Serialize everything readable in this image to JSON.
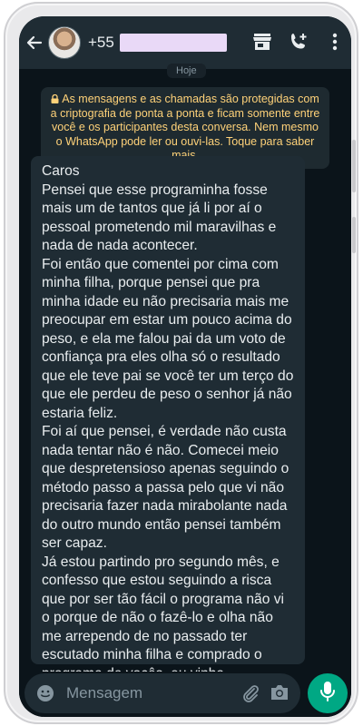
{
  "header": {
    "contact_number": "+55",
    "icons": [
      "back-arrow-icon",
      "avatar",
      "store-icon",
      "call-add-icon",
      "more-vert-icon"
    ]
  },
  "chat": {
    "date_label": "Hoje",
    "encryption_notice": "As mensagens e as chamadas são protegidas com a criptografia de ponta a ponta e ficam somente entre você e os participantes desta conversa. Nem mesmo o WhatsApp pode ler ou ouvi-las. Toque para saber mais.",
    "message_text": "Caros\nPensei que esse programinha fosse mais um de tantos que já li por aí o pessoal prometendo mil maravilhas e nada de nada acontecer.\nFoi então que comentei por cima com minha filha, porque pensei que pra minha idade eu não precisaria mais me preocupar em estar um pouco acima do peso, e ela me falou pai da um voto de confiança pra eles olha só o resultado que ele teve pai se você ter um terço do que ele perdeu de peso o senhor já não estaria feliz.\nFoi aí que pensei, é verdade não custa nada tentar não é não. Comecei meio que despretensioso apenas seguindo o método passo a passa pelo que vi não precisaria fazer nada mirabolante nada do outro mundo então pensei também ser capaz.\nJá estou partindo pro segundo mês, e confesso que estou seguindo a risca que por ser tão fácil o programa não vi o porque de não o fazê-lo e olha não me arrependo de no passado ter escutado minha filha e comprado o programa de vocês, eu vinha totalmente desacreditado e vocês me provaram que também sou capaz.\nSó tenho a agradecer."
  },
  "input": {
    "placeholder": "Mensagem"
  },
  "colors": {
    "header_bg": "#1f2c34",
    "chat_bg": "#0b141a",
    "bubble_bg": "#1f2c34",
    "notice_text": "#ffd279",
    "accent": "#00a884"
  }
}
